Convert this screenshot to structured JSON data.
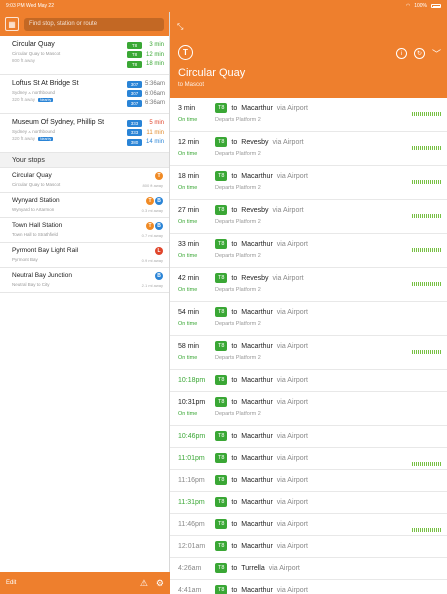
{
  "status_bar": {
    "time_date": "9:03 PM  Wed May 22",
    "battery": "100%"
  },
  "left": {
    "map_icon": "map-icon",
    "search_placeholder": "Find stop, station or route",
    "nearby": [
      {
        "name": "Circular Quay",
        "sub": "Circular Quay to Mascot",
        "dist": "800 ft away",
        "badge": "",
        "departures": [
          {
            "line": "T8",
            "color": "#3aa735",
            "time": "3 min",
            "time_color": "#3aa735"
          },
          {
            "line": "T8",
            "color": "#3aa735",
            "time": "12 min",
            "time_color": "#3aa735"
          },
          {
            "line": "T8",
            "color": "#3aa735",
            "time": "18 min",
            "time_color": "#3aa735"
          }
        ]
      },
      {
        "name": "Loftus St At Bridge St",
        "sub": "Sydney  ⟑ northbound",
        "dist": "320 ft away",
        "badge": "Nearby",
        "departures": [
          {
            "line": "307",
            "color": "#2a84d6",
            "time": "5:36am",
            "time_color": "#777"
          },
          {
            "line": "307",
            "color": "#2a84d6",
            "time": "6:06am",
            "time_color": "#777"
          },
          {
            "line": "307",
            "color": "#2a84d6",
            "time": "6:36am",
            "time_color": "#777"
          }
        ]
      },
      {
        "name": "Museum Of Sydney, Phillip St",
        "sub": "Sydney  ⟑ northbound",
        "dist": "320 ft away",
        "badge": "Nearby",
        "departures": [
          {
            "line": "333",
            "color": "#2a84d6",
            "time": "5 min",
            "time_color": "#e0452b"
          },
          {
            "line": "333",
            "color": "#2a84d6",
            "time": "11 min",
            "time_color": "#e08a2b"
          },
          {
            "line": "380",
            "color": "#2a84d6",
            "time": "14 min",
            "time_color": "#2a84d6"
          }
        ]
      }
    ],
    "your_stops_title": "Your stops",
    "stops": [
      {
        "name": "Circular Quay",
        "sub": "Circular Quay to Mascot",
        "dist": "800 ft away",
        "icons": [
          {
            "glyph": "T",
            "color": "#f08a24"
          }
        ]
      },
      {
        "name": "Wynyard Station",
        "sub": "Wynyard to Artarmon",
        "dist": "0.3 mi away",
        "icons": [
          {
            "glyph": "T",
            "color": "#f08a24"
          },
          {
            "glyph": "B",
            "color": "#2a84d6"
          }
        ]
      },
      {
        "name": "Town Hall Station",
        "sub": "Town Hall to Strathfield",
        "dist": "0.7 mi away",
        "icons": [
          {
            "glyph": "T",
            "color": "#f08a24"
          },
          {
            "glyph": "B",
            "color": "#2a84d6"
          }
        ]
      },
      {
        "name": "Pyrmont Bay Light Rail",
        "sub": "Pyrmont Bay",
        "dist": "0.9 mi away",
        "icons": [
          {
            "glyph": "L",
            "color": "#e0452b"
          }
        ]
      },
      {
        "name": "Neutral Bay Junction",
        "sub": "Neutral Bay to City",
        "dist": "2.1 mi away",
        "icons": [
          {
            "glyph": "B",
            "color": "#2a84d6"
          }
        ]
      }
    ],
    "footer": {
      "edit": "Edit",
      "warning_icon": "warning-icon",
      "settings_icon": "gear-icon"
    }
  },
  "right": {
    "header": {
      "expand_icon": "expand-icon",
      "mode_glyph": "T",
      "title": "Circular Quay",
      "subtitle": "to Mascot",
      "actions": [
        "info-icon",
        "refresh-icon",
        "chevron-down-icon"
      ]
    },
    "departures": [
      {
        "time": "3 min",
        "status": "On time",
        "line": "T8",
        "dest": "Macarthur",
        "via": "via Airport",
        "platform": "Departs Platform 2",
        "occupancy": true,
        "style": "normal"
      },
      {
        "time": "12 min",
        "status": "On time",
        "line": "T8",
        "dest": "Revesby",
        "via": "via Airport",
        "platform": "Departs Platform 2",
        "occupancy": true,
        "style": "normal"
      },
      {
        "time": "18 min",
        "status": "On time",
        "line": "T8",
        "dest": "Macarthur",
        "via": "via Airport",
        "platform": "Departs Platform 2",
        "occupancy": true,
        "style": "normal"
      },
      {
        "time": "27 min",
        "status": "On time",
        "line": "T8",
        "dest": "Revesby",
        "via": "via Airport",
        "platform": "Departs Platform 2",
        "occupancy": true,
        "style": "normal"
      },
      {
        "time": "33 min",
        "status": "On time",
        "line": "T8",
        "dest": "Macarthur",
        "via": "via Airport",
        "platform": "Departs Platform 2",
        "occupancy": true,
        "style": "normal"
      },
      {
        "time": "42 min",
        "status": "On time",
        "line": "T8",
        "dest": "Revesby",
        "via": "via Airport",
        "platform": "Departs Platform 2",
        "occupancy": true,
        "style": "normal"
      },
      {
        "time": "54 min",
        "status": "On time",
        "line": "T8",
        "dest": "Macarthur",
        "via": "via Airport",
        "platform": "Departs Platform 2",
        "occupancy": false,
        "style": "normal"
      },
      {
        "time": "58 min",
        "status": "On time",
        "line": "T8",
        "dest": "Macarthur",
        "via": "via Airport",
        "platform": "Departs Platform 2",
        "occupancy": true,
        "style": "normal"
      },
      {
        "time": "10:18pm",
        "status": "",
        "line": "T8",
        "dest": "Macarthur",
        "via": "via Airport",
        "platform": "",
        "occupancy": false,
        "style": "green"
      },
      {
        "time": "10:31pm",
        "status": "On time",
        "line": "T8",
        "dest": "Macarthur",
        "via": "via Airport",
        "platform": "Departs Platform 2",
        "occupancy": false,
        "style": "normal"
      },
      {
        "time": "10:46pm",
        "status": "",
        "line": "T8",
        "dest": "Macarthur",
        "via": "via Airport",
        "platform": "",
        "occupancy": false,
        "style": "green"
      },
      {
        "time": "11:01pm",
        "status": "",
        "line": "T8",
        "dest": "Macarthur",
        "via": "via Airport",
        "platform": "",
        "occupancy": true,
        "style": "green"
      },
      {
        "time": "11:16pm",
        "status": "",
        "line": "T8",
        "dest": "Macarthur",
        "via": "via Airport",
        "platform": "",
        "occupancy": false,
        "style": "grey"
      },
      {
        "time": "11:31pm",
        "status": "",
        "line": "T8",
        "dest": "Macarthur",
        "via": "via Airport",
        "platform": "",
        "occupancy": false,
        "style": "green"
      },
      {
        "time": "11:46pm",
        "status": "",
        "line": "T8",
        "dest": "Macarthur",
        "via": "via Airport",
        "platform": "",
        "occupancy": true,
        "style": "grey"
      },
      {
        "time": "12:01am",
        "status": "",
        "line": "T8",
        "dest": "Macarthur",
        "via": "via Airport",
        "platform": "",
        "occupancy": false,
        "style": "grey"
      },
      {
        "time": "4:26am",
        "status": "",
        "line": "T8",
        "dest": "Turrella",
        "via": "via Airport",
        "platform": "",
        "occupancy": false,
        "style": "grey"
      },
      {
        "time": "4:41am",
        "status": "",
        "line": "T8",
        "dest": "Macarthur",
        "via": "via Airport",
        "platform": "",
        "occupancy": false,
        "style": "grey"
      }
    ],
    "connector_to": "to",
    "accent": "#ee7f2d",
    "line_color": "#3aa735"
  }
}
